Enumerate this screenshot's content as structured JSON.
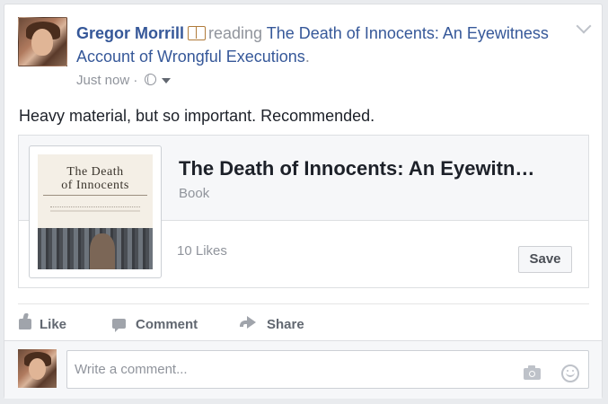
{
  "post": {
    "author": "Gregor Morrill",
    "activity_verb": "reading",
    "activity_object": "The Death of Innocents: An Eyewitness Account of Wrongful Executions",
    "activity_period": ".",
    "timestamp": "Just now",
    "separator": "·",
    "message": "Heavy material, but so important. Recommended."
  },
  "attachment": {
    "title": "The Death of Innocents: An Eyewitn…",
    "type": "Book",
    "likes": "10 Likes",
    "save_label": "Save",
    "cover_title_line1": "The Death",
    "cover_title_line2": "of Innocents"
  },
  "actions": {
    "like_label": "Like",
    "comment_label": "Comment",
    "share_label": "Share"
  },
  "comment_box": {
    "placeholder": "Write a comment..."
  },
  "icons": {
    "activity": "book-icon",
    "privacy": "globe-icon",
    "menu": "chevron-down-icon",
    "like": "thumbs-up-icon",
    "comment": "speech-bubble-icon",
    "share": "share-arrow-icon",
    "camera": "camera-icon",
    "emoji": "smiley-icon"
  },
  "colors": {
    "link": "#365899",
    "muted": "#90949c",
    "background": "#e9ebee"
  }
}
